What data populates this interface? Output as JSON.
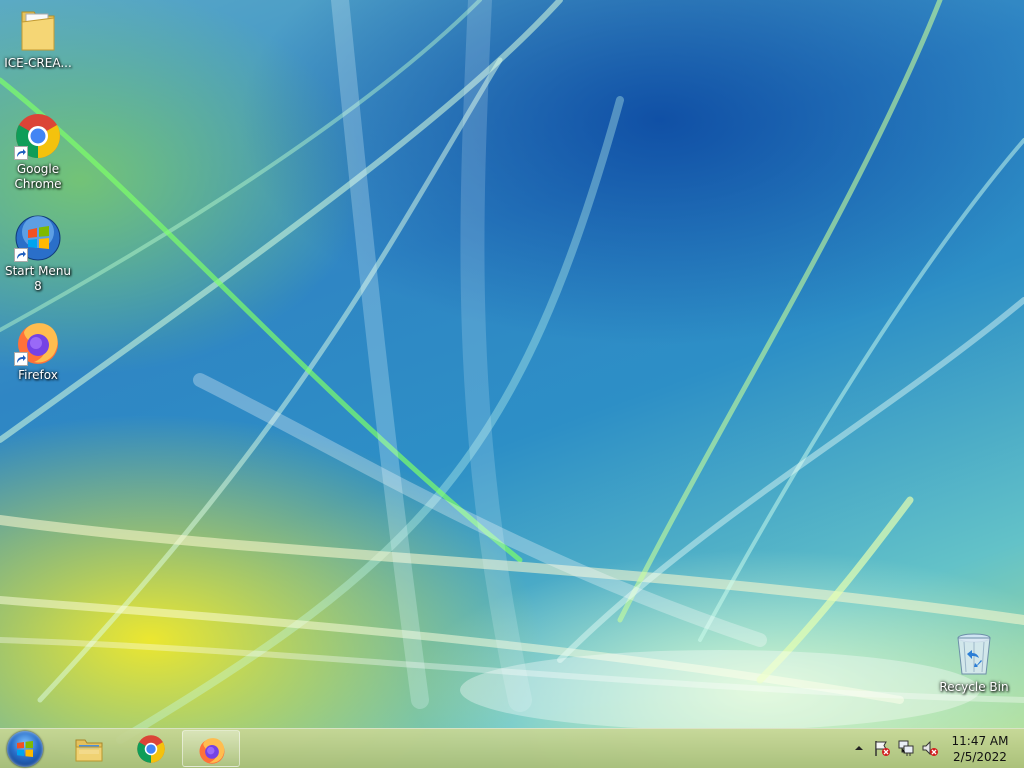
{
  "desktop": {
    "icons": [
      {
        "label": "ICE-CREA...",
        "icon": "folder-icon"
      },
      {
        "label": "Google Chrome",
        "icon": "chrome-icon"
      },
      {
        "label": "Start Menu 8",
        "icon": "windows-globe-icon"
      },
      {
        "label": "Firefox",
        "icon": "firefox-icon"
      },
      {
        "label": "Recycle Bin",
        "icon": "recycle-bin-icon"
      }
    ]
  },
  "taskbar": {
    "start": {
      "icon": "start-orb-icon"
    },
    "pinned": [
      {
        "icon": "file-explorer-icon",
        "active": false
      },
      {
        "icon": "chrome-icon",
        "active": false
      },
      {
        "icon": "firefox-icon",
        "active": true
      }
    ],
    "tray": {
      "icons": [
        "show-hidden-icons-chevron",
        "action-center-flag-icon",
        "network-icon",
        "volume-muted-icon"
      ],
      "time": "11:47 AM",
      "date": "2/5/2022"
    }
  },
  "colors": {
    "taskbar": "#b8c98a",
    "wallpaper_blue": "#2f86c4",
    "wallpaper_yellow": "#f5eb28"
  }
}
